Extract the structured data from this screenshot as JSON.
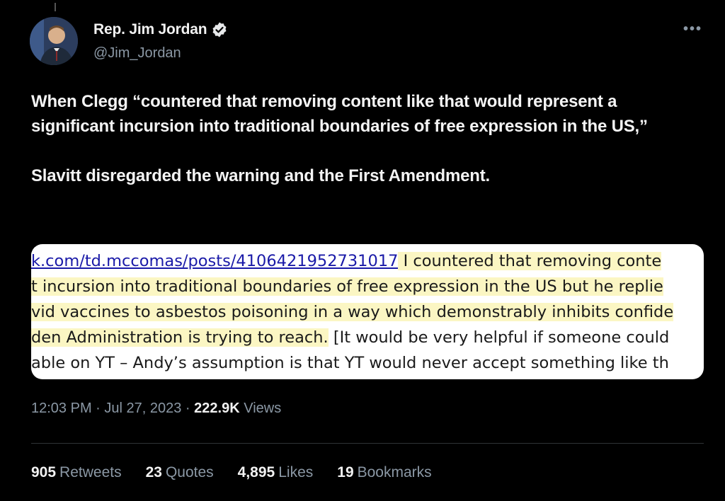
{
  "author": {
    "name": "Rep. Jim Jordan",
    "handle": "@Jim_Jordan",
    "verified_icon": "verified-badge-icon",
    "verified_color": "#1d9bf0"
  },
  "more_label": "•••",
  "tweet": {
    "paragraph_1": "When Clegg “countered that removing content like that would represent a significant incursion into traditional boundaries of free expression in the US,”",
    "paragraph_2": "Slavitt disregarded the warning and the First Amendment."
  },
  "document_image": {
    "highlight_color": "#fbf6c3",
    "link_color": "#1a1aa8",
    "link_text": "k.com/td.mccomas/posts/4106421952731017",
    "line_1_rest": " I countered that removing conte",
    "line_2": "t incursion into traditional boundaries of free expression in the US but he replie",
    "line_3": "vid vaccines to asbestos poisoning in a way which demonstrably inhibits confide",
    "line_4_highlighted": "den Administration is trying to reach.",
    "line_4_rest": " [It would be very helpful if someone could",
    "line_5": "able on YT – Andy’s assumption is that YT would never accept something like th"
  },
  "meta": {
    "time": "12:03 PM",
    "separator": " · ",
    "date": "Jul 27, 2023",
    "views_count": "222.9K",
    "views_label": " Views"
  },
  "stats": {
    "retweets_count": "905",
    "retweets_label": "Retweets",
    "quotes_count": "23",
    "quotes_label": "Quotes",
    "likes_count": "4,895",
    "likes_label": "Likes",
    "bookmarks_count": "19",
    "bookmarks_label": "Bookmarks"
  }
}
